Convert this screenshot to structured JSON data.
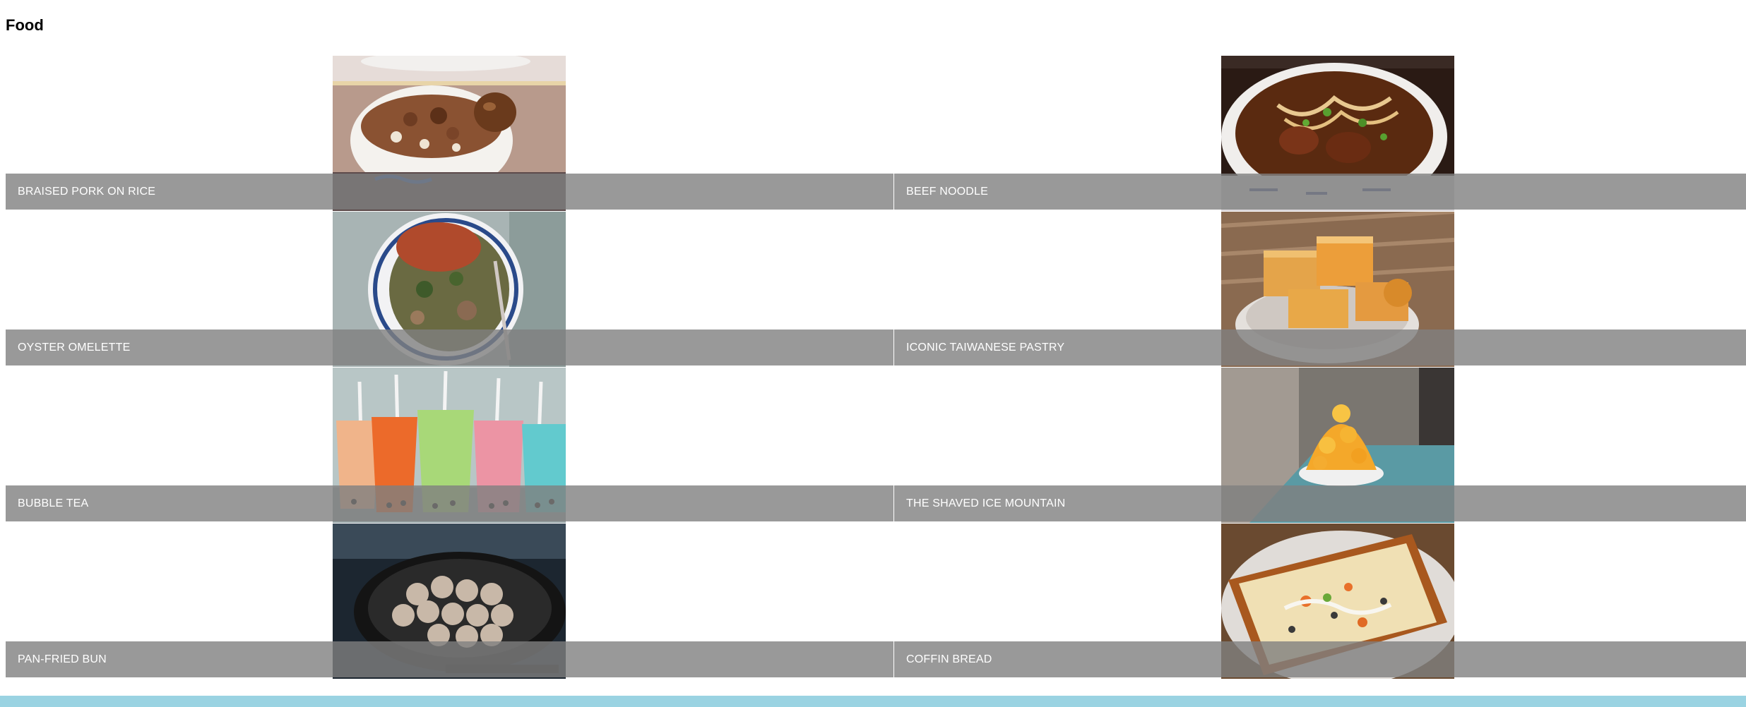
{
  "page": {
    "title": "Food"
  },
  "food_items": [
    {
      "label": "BRAISED PORK ON RICE",
      "photo": "braised-pork-rice-photo"
    },
    {
      "label": "BEEF NOODLE",
      "photo": "beef-noodle-photo"
    },
    {
      "label": "OYSTER OMELETTE",
      "photo": "oyster-omelette-photo"
    },
    {
      "label": "ICONIC TAIWANESE PASTRY",
      "photo": "pineapple-cake-photo"
    },
    {
      "label": "BUBBLE TEA",
      "photo": "bubble-tea-photo"
    },
    {
      "label": "THE SHAVED ICE MOUNTAIN",
      "photo": "shaved-ice-photo"
    },
    {
      "label": "PAN-FRIED BUN",
      "photo": "pan-fried-bun-photo"
    },
    {
      "label": "COFFIN BREAD",
      "photo": "coffin-bread-photo"
    }
  ],
  "colors": {
    "caption_bar": "#808080cc",
    "caption_text": "#ffffff",
    "footer_band": "#9ad3e2"
  }
}
